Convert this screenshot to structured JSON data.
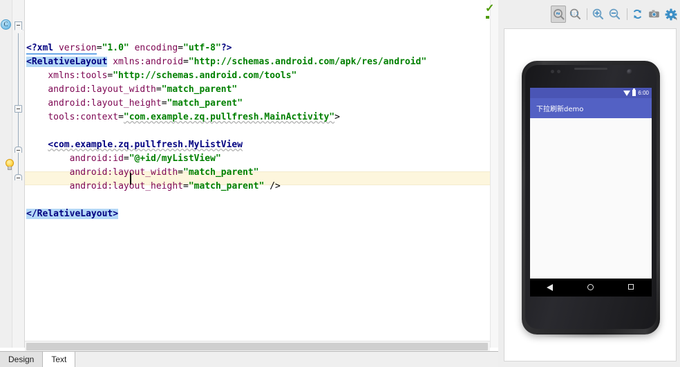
{
  "editor": {
    "gutter": {
      "class_marker_label": "C"
    },
    "code_lines": [
      {
        "id": "line-xml-decl",
        "tokens": [
          {
            "text": "<?",
            "cls": "t-proc"
          },
          {
            "text": "xml",
            "cls": "t-proc"
          },
          {
            "text": " ",
            "cls": "t-punct"
          },
          {
            "text": "version",
            "cls": "t-attr"
          },
          {
            "text": "=",
            "cls": "t-eq"
          },
          {
            "text": "\"1.0\"",
            "cls": "t-val"
          },
          {
            "text": " ",
            "cls": "t-punct"
          },
          {
            "text": "encoding",
            "cls": "t-attr"
          },
          {
            "text": "=",
            "cls": "t-eq"
          },
          {
            "text": "\"utf-8\"",
            "cls": "t-val"
          },
          {
            "text": "?>",
            "cls": "t-proc"
          }
        ]
      },
      {
        "id": "line-relativelayout-open",
        "tokens": [
          {
            "text": "<RelativeLayout",
            "cls": "t-tag hl-tag"
          },
          {
            "text": " ",
            "cls": "t-punct"
          },
          {
            "text": "xmlns:android",
            "cls": "t-attr"
          },
          {
            "text": "=",
            "cls": "t-eq"
          },
          {
            "text": "\"http://schemas.android.com/apk/res/android\"",
            "cls": "t-val"
          }
        ]
      },
      {
        "id": "line-xmlns-tools",
        "tokens": [
          {
            "text": "    ",
            "cls": "t-punct"
          },
          {
            "text": "xmlns:tools",
            "cls": "t-attr"
          },
          {
            "text": "=",
            "cls": "t-eq"
          },
          {
            "text": "\"http://schemas.android.com/tools\"",
            "cls": "t-val"
          }
        ]
      },
      {
        "id": "line-root-layout-width",
        "tokens": [
          {
            "text": "    ",
            "cls": "t-punct"
          },
          {
            "text": "android:layout_width",
            "cls": "t-attr"
          },
          {
            "text": "=",
            "cls": "t-eq"
          },
          {
            "text": "\"match_parent\"",
            "cls": "t-val"
          }
        ]
      },
      {
        "id": "line-root-layout-height",
        "tokens": [
          {
            "text": "    ",
            "cls": "t-punct"
          },
          {
            "text": "android:layout_height",
            "cls": "t-attr"
          },
          {
            "text": "=",
            "cls": "t-eq"
          },
          {
            "text": "\"match_parent\"",
            "cls": "t-val"
          }
        ]
      },
      {
        "id": "line-tools-context",
        "tokens": [
          {
            "text": "    ",
            "cls": "t-punct"
          },
          {
            "text": "tools:context",
            "cls": "t-attr"
          },
          {
            "text": "=",
            "cls": "t-eq"
          },
          {
            "text": "\"com.example.zq.pullfresh.MainActivity\"",
            "cls": "t-val"
          },
          {
            "text": ">",
            "cls": "t-punct"
          }
        ]
      },
      {
        "id": "line-blank-1",
        "tokens": []
      },
      {
        "id": "line-mylistview-open",
        "tokens": [
          {
            "text": "    ",
            "cls": "t-punct"
          },
          {
            "text": "<com.example.zq.pullfresh.MyListView",
            "cls": "t-tag"
          }
        ]
      },
      {
        "id": "line-mylistview-id",
        "tokens": [
          {
            "text": "        ",
            "cls": "t-punct"
          },
          {
            "text": "android:id",
            "cls": "t-attr"
          },
          {
            "text": "=",
            "cls": "t-eq"
          },
          {
            "text": "\"@+id/myListView\"",
            "cls": "t-val"
          }
        ]
      },
      {
        "id": "line-mylistview-layout-width",
        "tokens": [
          {
            "text": "        ",
            "cls": "t-punct"
          },
          {
            "text": "android:layout_width",
            "cls": "t-attr"
          },
          {
            "text": "=",
            "cls": "t-eq"
          },
          {
            "text": "\"match_parent\"",
            "cls": "t-val"
          }
        ]
      },
      {
        "id": "line-mylistview-layout-height",
        "tokens": [
          {
            "text": "        ",
            "cls": "t-punct"
          },
          {
            "text": "android:layout_height",
            "cls": "t-attr"
          },
          {
            "text": "=",
            "cls": "t-eq"
          },
          {
            "text": "\"match_parent\"",
            "cls": "t-val"
          },
          {
            "text": " />",
            "cls": "t-punct"
          }
        ]
      },
      {
        "id": "line-blank-2",
        "tokens": []
      },
      {
        "id": "line-relativelayout-close",
        "tokens": [
          {
            "text": "</RelativeLayout>",
            "cls": "t-tag hl-tag"
          }
        ]
      }
    ],
    "tabs": [
      {
        "id": "tab-design",
        "label": "Design",
        "active": false
      },
      {
        "id": "tab-text",
        "label": "Text",
        "active": true
      }
    ]
  },
  "preview": {
    "toolbar_buttons": [
      {
        "id": "zoom-to-fit",
        "icon": "zoom-fit-icon",
        "pressed": true
      },
      {
        "id": "zoom-actual-size",
        "icon": "zoom-actual-size-icon",
        "pressed": false
      },
      {
        "id": "zoom-in",
        "icon": "zoom-in-icon",
        "pressed": false
      },
      {
        "id": "zoom-out",
        "icon": "zoom-out-icon",
        "pressed": false
      },
      {
        "id": "refresh",
        "icon": "refresh-icon",
        "pressed": false
      },
      {
        "id": "screenshot",
        "icon": "camera-icon",
        "pressed": false
      },
      {
        "id": "settings",
        "icon": "gear-icon",
        "pressed": false
      }
    ],
    "device": {
      "status_bar": {
        "time": "6:00"
      },
      "action_bar": {
        "title": "下拉刷新demo"
      }
    }
  },
  "colors": {
    "action_bar": "#5361c4",
    "status_bar": "#4a55b5",
    "tag": "#000080",
    "attribute": "#7d0552",
    "value": "#008000",
    "caret_line": "#fdf6dd",
    "tag_highlight": "#b4d8f7"
  }
}
